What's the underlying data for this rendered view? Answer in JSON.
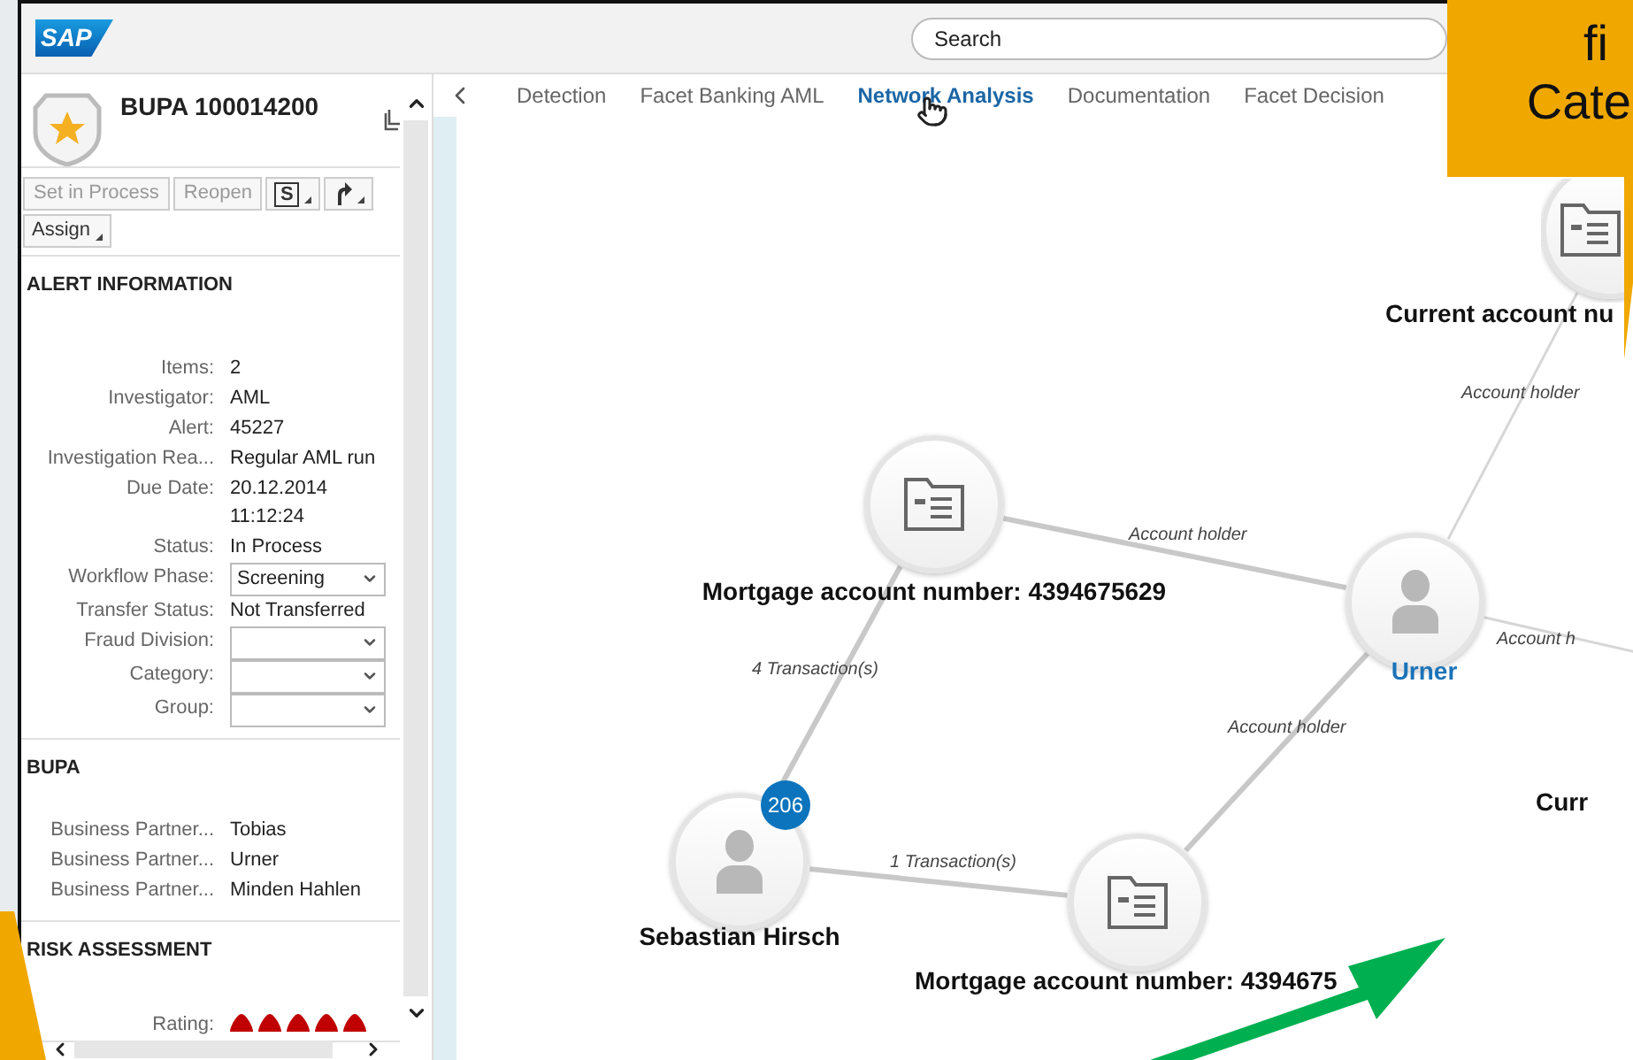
{
  "header": {
    "logo": "SAP",
    "search": {
      "placeholder": "Search"
    }
  },
  "side_panel": {
    "title": "BUPA 100014200",
    "toolbar": [
      {
        "kind": "button",
        "label": "Set in Process",
        "disabled": true
      },
      {
        "kind": "button",
        "label": "Reopen",
        "disabled": true
      },
      {
        "kind": "menu",
        "label": "S",
        "disabled": false
      },
      {
        "kind": "icon-menu",
        "disabled": false
      },
      {
        "kind": "menu",
        "label": "Assign",
        "disabled": false
      }
    ],
    "sections": [
      {
        "title": "ALERT INFORMATION",
        "fields": [
          {
            "kind": "text",
            "label": "Items:",
            "value": "2"
          },
          {
            "kind": "text",
            "label": "Investigator:",
            "value": "AML"
          },
          {
            "kind": "text",
            "label": "Alert:",
            "value": "45227"
          },
          {
            "kind": "text",
            "label": "Investigation Rea...",
            "value": "Regular AML run"
          },
          {
            "kind": "stacked",
            "label": "Due Date:",
            "values": [
              "20.12.2014",
              "11:12:24"
            ]
          },
          {
            "kind": "text",
            "label": "Status:",
            "value": "In Process"
          },
          {
            "kind": "select",
            "label": "Workflow Phase:",
            "value": "Screening"
          },
          {
            "kind": "text",
            "label": "Transfer Status:",
            "value": "Not Transferred"
          },
          {
            "kind": "select",
            "label": "Fraud Division:"
          },
          {
            "kind": "select",
            "label": "Category:"
          },
          {
            "kind": "select",
            "label": "Group:"
          }
        ]
      },
      {
        "title": "BUPA",
        "fields": [
          {
            "kind": "text",
            "label": "Business Partner...",
            "value": "Tobias"
          },
          {
            "kind": "text",
            "label": "Business Partner...",
            "value": "Urner"
          },
          {
            "kind": "text",
            "label": "Business Partner...",
            "value": "Minden Hahlen"
          }
        ]
      },
      {
        "title": "RISK ASSESSMENT",
        "fields": [
          {
            "kind": "rating",
            "label": "Rating:",
            "stars": 5
          }
        ]
      }
    ]
  },
  "tabs": [
    {
      "label": "Detection",
      "selected": false
    },
    {
      "label": "Facet Banking AML",
      "selected": false
    },
    {
      "label": "Network Analysis",
      "selected": true
    },
    {
      "label": "Documentation",
      "selected": false
    },
    {
      "label": "Facet Decision",
      "selected": false
    }
  ],
  "graph": {
    "nodes": [
      {
        "kind": "account",
        "label": "Mortgage account number: 4394675629",
        "highlighted": false
      },
      {
        "kind": "person",
        "label": "Urner",
        "highlighted": true
      },
      {
        "kind": "person",
        "label": "Sebastian Hirsch",
        "highlighted": false,
        "badge": "206"
      },
      {
        "kind": "account",
        "label": "Mortgage account number: 4394675",
        "highlighted": false
      },
      {
        "kind": "account",
        "label": "Current account nu",
        "highlighted": false
      },
      {
        "kind": "label-only",
        "label": "Curr",
        "highlighted": false
      }
    ],
    "edges": [
      {
        "label": "Account holder"
      },
      {
        "label": "4 Transaction(s)"
      },
      {
        "label": "Account holder"
      },
      {
        "label": "1 Transaction(s)"
      },
      {
        "label": "Account holder"
      },
      {
        "label": "Account h"
      }
    ]
  },
  "callout": {
    "lines": [
      "fi",
      "Cate"
    ]
  }
}
